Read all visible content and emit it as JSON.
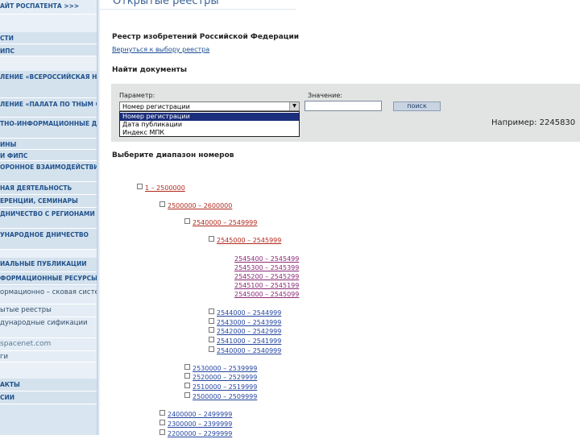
{
  "sidebar": {
    "items": [
      {
        "label": "АЙТ РОСПАТЕНТА >>>",
        "style": "top"
      },
      {
        "label": "СТИ",
        "style": "head"
      },
      {
        "label": "ИПС",
        "style": "head"
      },
      {
        "label": "ЛЕНИЕ «ВСЕРОССИЙСКАЯ НТНО-ТЕХНИЧЕСКАЯ ЛИОТЕКА»",
        "style": "head"
      },
      {
        "label": "ЛЕНИЕ «ПАЛАТА ПО ТНЫМ СПОРАМ»",
        "style": "head"
      },
      {
        "label": "ТНО-ИНФОРМАЦИОННЫЕ ДУКТЫ",
        "style": "head"
      },
      {
        "label": "ИНЫ",
        "style": "head"
      },
      {
        "label": "И ФИПС",
        "style": "head"
      },
      {
        "label": "ОРОННОЕ ВЗАИМОДЕЙСТВИЕ ВИТЕЛЯМИ",
        "style": "head"
      },
      {
        "label": "НАЯ ДЕЯТЕЛЬНОСТЬ",
        "style": "head"
      },
      {
        "label": "ЕРЕНЦИИ, СЕМИНАРЫ",
        "style": "head"
      },
      {
        "label": "ДНИЧЕСТВО С РЕГИОНАМИ ИИ",
        "style": "head"
      },
      {
        "label": "УНАРОДНОЕ ДНИЧЕСТВО",
        "style": "head"
      },
      {
        "label": "ИАЛЬНЫЕ ПУБЛИКАЦИИ",
        "style": "head"
      },
      {
        "label": "ФОРМАЦИОННЫЕ РЕСУРСЫ",
        "style": "head"
      },
      {
        "label": "ормационно – сковая система",
        "style": "plain"
      },
      {
        "label": "ытые реестры",
        "style": "plain"
      },
      {
        "label": "дународные сификации",
        "style": "plain"
      },
      {
        "label": "spacenet.com",
        "style": "url"
      },
      {
        "label": "ги",
        "style": "plain"
      },
      {
        "label": "АКТЫ",
        "style": "head"
      },
      {
        "label": "СИИ",
        "style": "head"
      }
    ]
  },
  "main": {
    "page_title": "Открытые реестры",
    "registry_title": "Реестр изобретений Российской Федерации",
    "back_link": "Вернуться к выбору реестра",
    "find_title": "Найти документы",
    "search": {
      "param_label": "Параметр:",
      "value_label": "Значение:",
      "param_selected": "Номер регистрации",
      "param_options": [
        "Номер регистрации",
        "Дата публикации",
        "Индекс МПК"
      ],
      "value": "",
      "button_label": "поиск",
      "example": "Например: 2245830"
    },
    "range_title": "Выберите диапазон номеров",
    "tree": [
      {
        "label": "1 – 2500000",
        "level": 0
      },
      {
        "label": "2500000 – 2600000",
        "level": 1
      },
      {
        "label": "2540000 – 2549999",
        "level": 2
      },
      {
        "label": "2545000 – 2545999",
        "level": 3
      },
      {
        "label": "2545400 – 2545499",
        "level": 4
      },
      {
        "label": "2545300 – 2545399",
        "level": 4
      },
      {
        "label": "2545200 – 2545299",
        "level": 4
      },
      {
        "label": "2545100 – 2545199",
        "level": 4
      },
      {
        "label": "2545000 – 2545099",
        "level": 4
      },
      {
        "label": "2544000 – 2544999",
        "level": 3
      },
      {
        "label": "2543000 – 2543999",
        "level": 3
      },
      {
        "label": "2542000 – 2542999",
        "level": 3
      },
      {
        "label": "2541000 – 2541999",
        "level": 3
      },
      {
        "label": "2540000 – 2540999",
        "level": 3
      },
      {
        "label": "2530000 – 2539999",
        "level": 2
      },
      {
        "label": "2520000 – 2529999",
        "level": 2
      },
      {
        "label": "2510000 – 2519999",
        "level": 2
      },
      {
        "label": "2500000 – 2509999",
        "level": 2
      },
      {
        "label": "2400000 – 2499999",
        "level": 1
      },
      {
        "label": "2300000 – 2399999",
        "level": 1
      },
      {
        "label": "2200000 – 2299999",
        "level": 1
      }
    ]
  },
  "colors": {
    "link": "#b22a1e",
    "leaf_link": "#8a2a78",
    "blue_link": "#2546a0",
    "sidebar_text": "#21528c"
  }
}
